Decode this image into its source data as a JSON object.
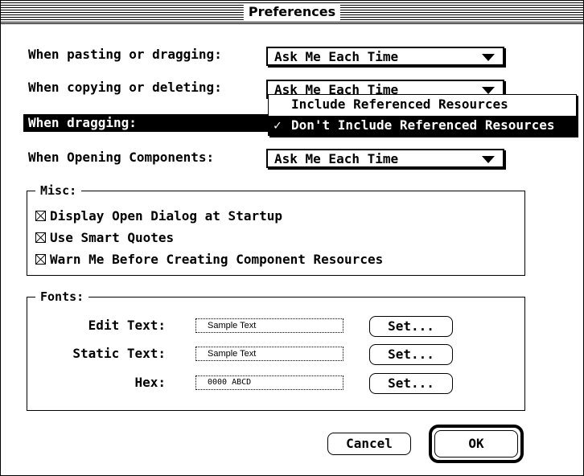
{
  "window": {
    "title": "Preferences"
  },
  "rows": [
    {
      "label": "When pasting or dragging:",
      "value": "Ask Me Each Time"
    },
    {
      "label": "When copying or deleting:",
      "value": "Ask Me Each Time"
    },
    {
      "label": "When dragging:"
    },
    {
      "label": "When Opening Components:",
      "value": "Ask Me Each Time"
    }
  ],
  "dragging_menu": {
    "items": [
      {
        "label": "Include Referenced Resources",
        "checked": false,
        "highlighted": false
      },
      {
        "label": "Don't Include Referenced Resources",
        "checked": true,
        "highlighted": true
      }
    ],
    "check_glyph": "✓"
  },
  "misc": {
    "title": "Misc:",
    "checkboxes": [
      {
        "label": "Display Open Dialog at Startup",
        "checked": true
      },
      {
        "label": "Use Smart Quotes",
        "checked": true
      },
      {
        "label": "Warn Me Before Creating Component Resources",
        "checked": true
      }
    ]
  },
  "fonts": {
    "title": "Fonts:",
    "rows": [
      {
        "label": "Edit Text:",
        "sample": "Sample Text",
        "button": "Set..."
      },
      {
        "label": "Static Text:",
        "sample": "Sample Text",
        "button": "Set..."
      },
      {
        "label": "Hex:",
        "sample": "0000  ABCD",
        "button": "Set..."
      }
    ]
  },
  "buttons": {
    "cancel": "Cancel",
    "ok": "OK"
  }
}
